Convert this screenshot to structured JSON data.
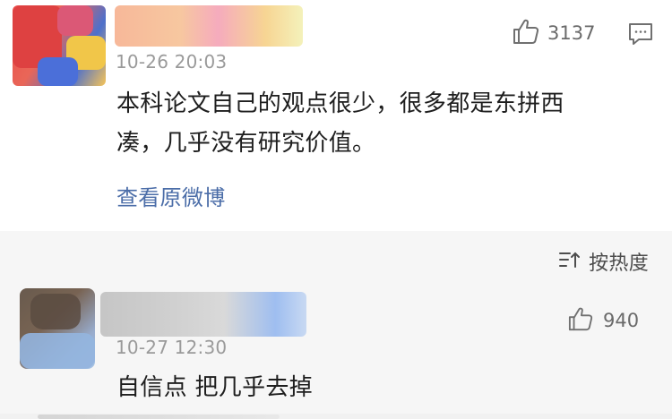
{
  "comments": [
    {
      "time": "10-26 20:03",
      "text": "本科论文自己的观点很少，很多都是东拼西\n凑，几乎没有研究价值。",
      "like_count": "3137",
      "view_weibo": "查看原微博",
      "avatar_icon": "avatar",
      "like_icon": "thumbs-up-icon",
      "comment_icon": "comment-icon"
    },
    {
      "time": "10-27 12:30",
      "text": "自信点 把几乎去掉",
      "like_count": "940",
      "avatar_icon": "avatar",
      "like_icon": "thumbs-up-icon"
    }
  ],
  "sort": {
    "label": "按热度",
    "icon": "sort-icon"
  },
  "colors": {
    "link": "#4b6da8",
    "meta": "#9a9a9a",
    "text": "#1e1e1e",
    "panel_bg": "#f6f6f6"
  }
}
